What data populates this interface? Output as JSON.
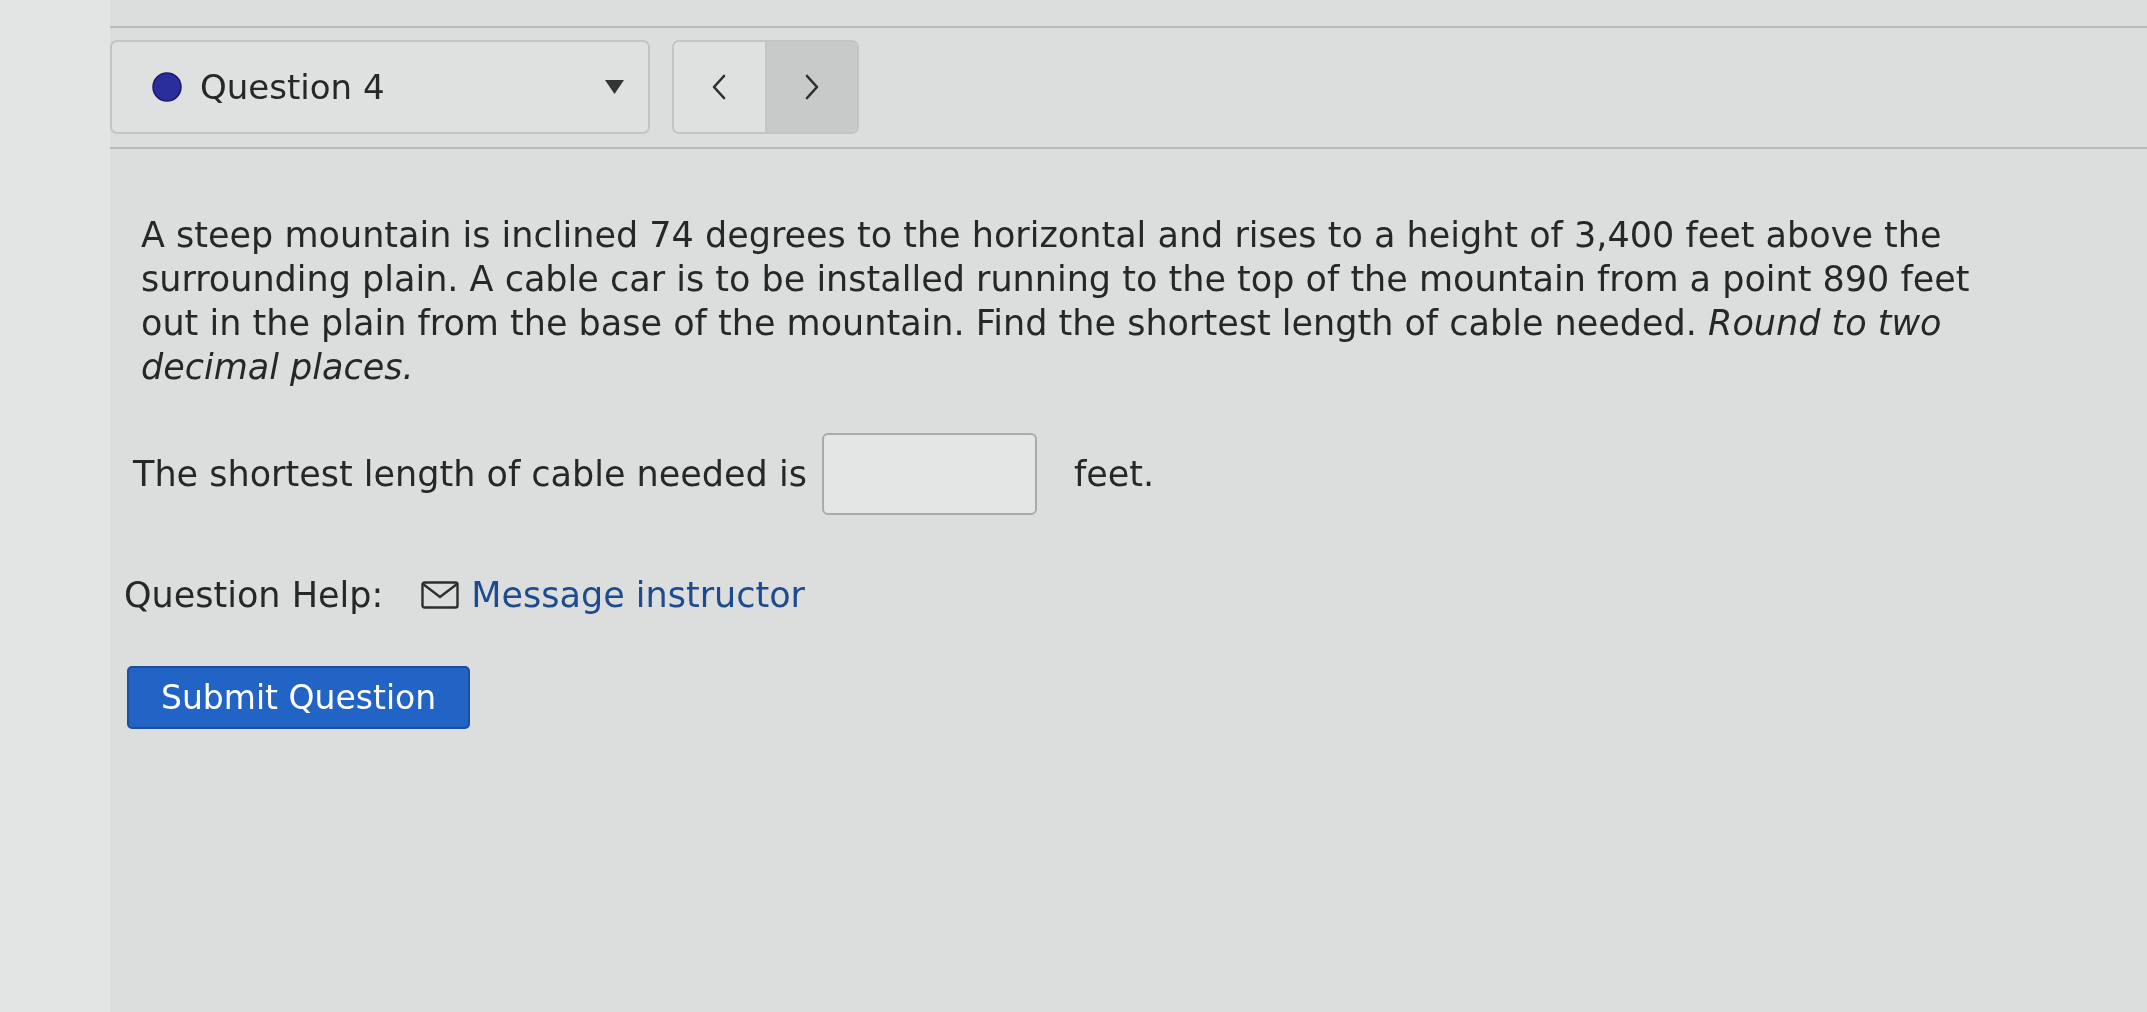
{
  "question_selector": {
    "label": "Question 4"
  },
  "question": {
    "text": "A steep mountain is inclined 74 degrees to the horizontal and rises to a height of 3,400 feet above the surrounding plain. A cable car is to be installed running to the top of the mountain from a point 890 feet out in the plain from the base of the mountain. Find the shortest length of cable needed. *Round to two decimal places.*"
  },
  "answer": {
    "prefix": "The shortest length of cable needed is",
    "suffix": "feet."
  },
  "help": {
    "label": "Question Help:",
    "link": "Message instructor"
  },
  "submit_button": {
    "label": "Submit Question"
  }
}
